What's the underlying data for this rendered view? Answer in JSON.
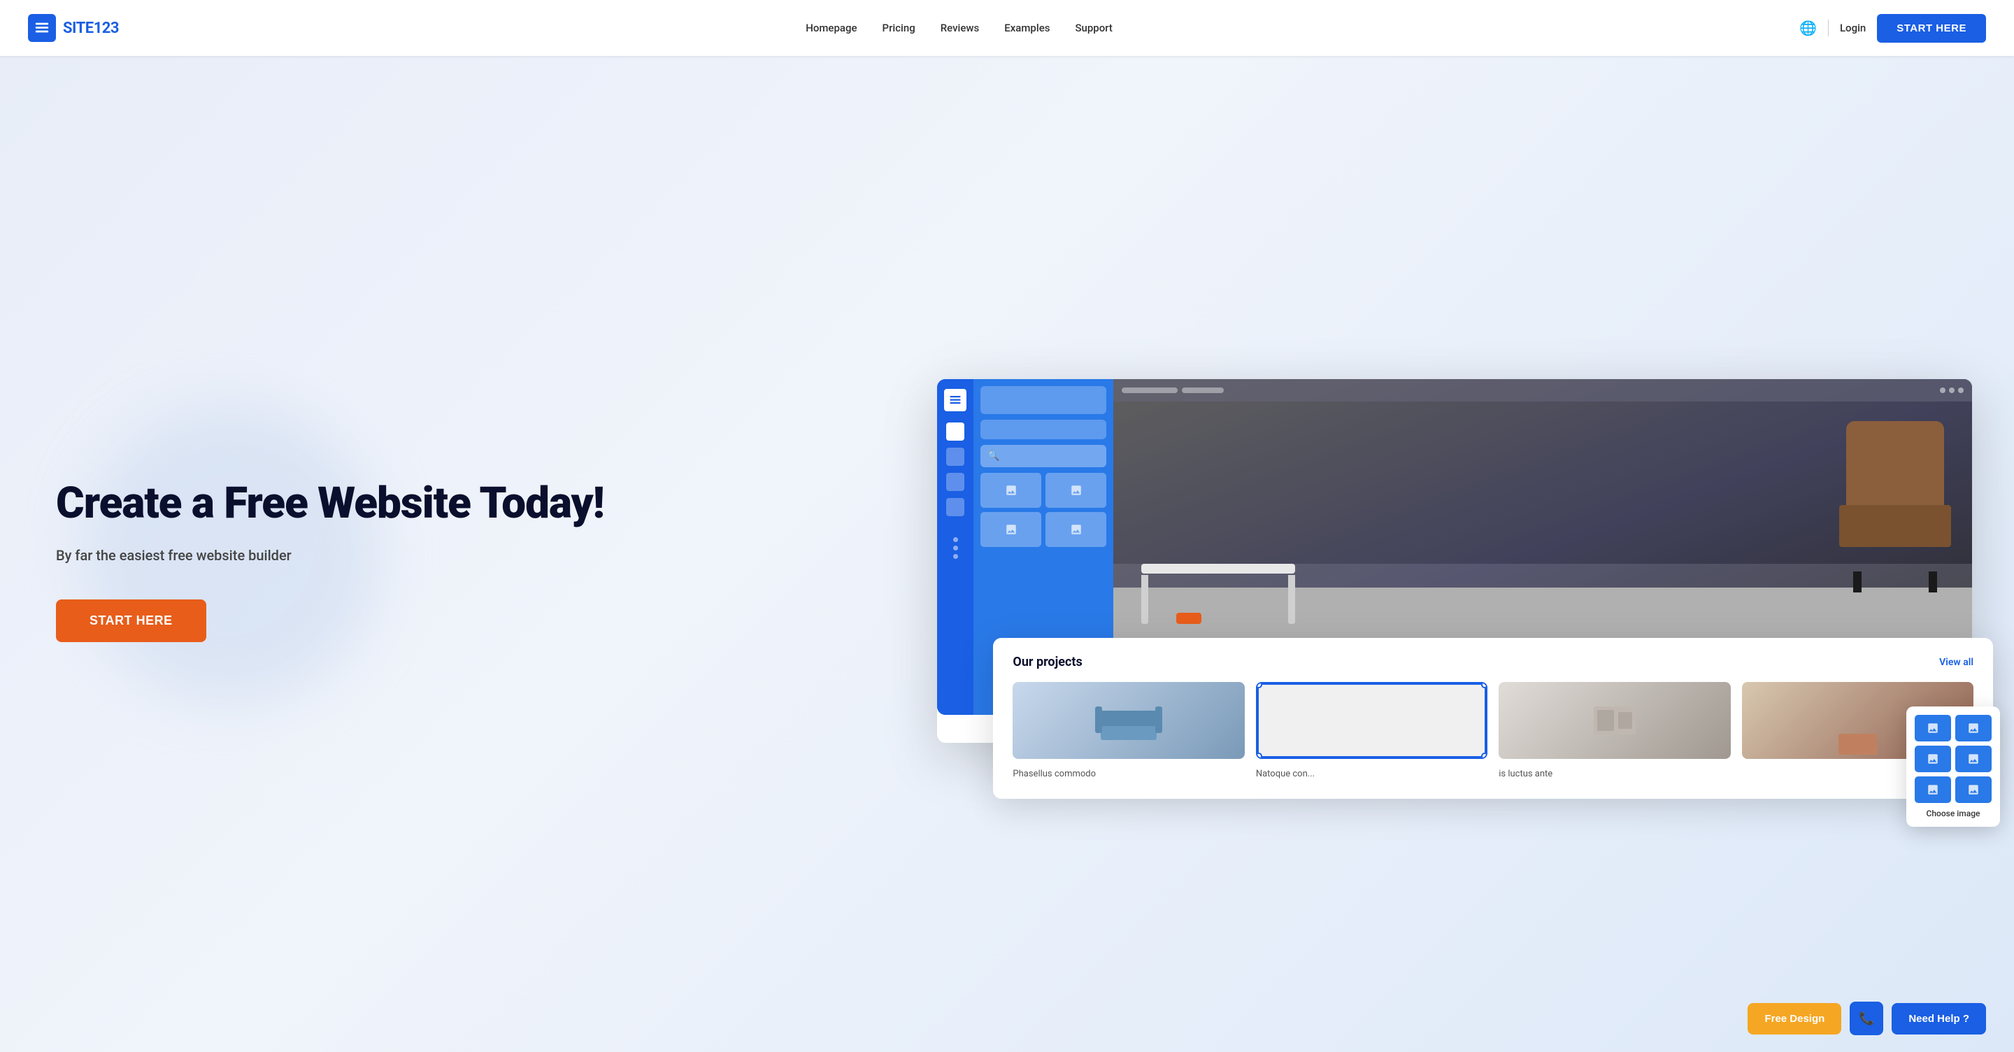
{
  "brand": {
    "name_prefix": "SITE",
    "name_suffix": "123"
  },
  "header": {
    "nav": {
      "items": [
        {
          "label": "Homepage",
          "href": "#"
        },
        {
          "label": "Pricing",
          "href": "#"
        },
        {
          "label": "Reviews",
          "href": "#"
        },
        {
          "label": "Examples",
          "href": "#"
        },
        {
          "label": "Support",
          "href": "#"
        }
      ],
      "login_label": "Login",
      "start_label": "START HERE"
    }
  },
  "hero": {
    "title": "Create a Free Website Today!",
    "subtitle": "By far the easiest free website builder",
    "cta_label": "START HERE"
  },
  "projects_card": {
    "title": "Our projects",
    "view_all": "View all",
    "items": [
      {
        "label": "Phasellus commodo"
      },
      {
        "label": "Natoque con..."
      },
      {
        "label": "is luctus ante"
      },
      {
        "label": ""
      }
    ]
  },
  "image_picker": {
    "label": "Choose image"
  },
  "bottom_bar": {
    "free_design": "Free Design",
    "need_help": "Need Help ?"
  }
}
